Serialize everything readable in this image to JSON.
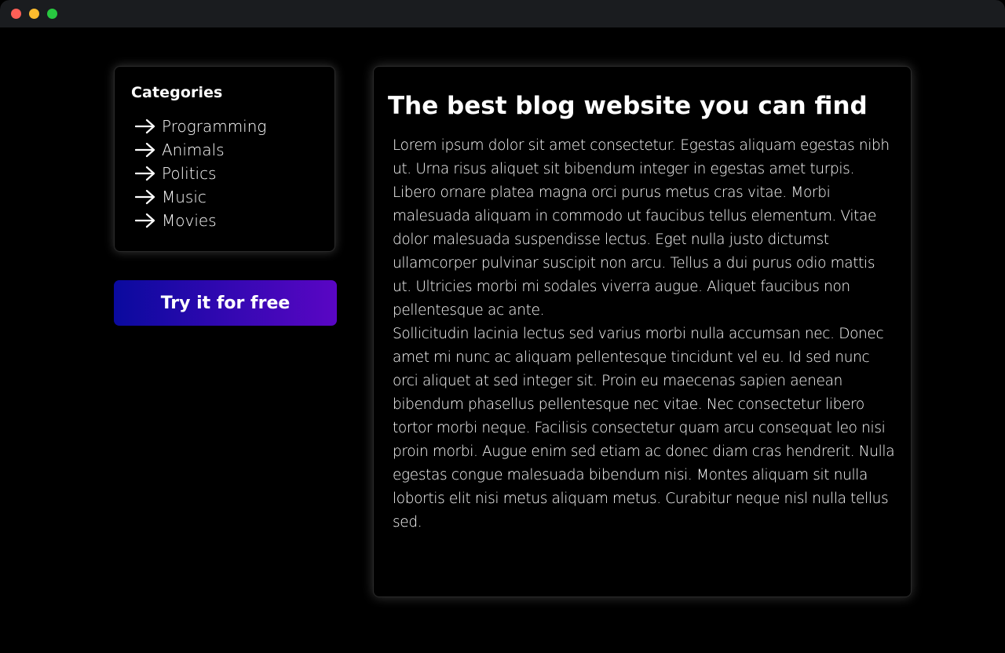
{
  "window": {
    "controls": {
      "close": "#ff5f57",
      "minimize": "#febc2e",
      "zoom": "#28c840"
    }
  },
  "colors": {
    "background": "#000000",
    "titlebar": "#1a1c1f",
    "text": "#ffffff",
    "button_gradient_start": "#0a0a9e",
    "button_gradient_end": "#5a06c4"
  },
  "sidebar": {
    "title": "Categories",
    "items": [
      {
        "label": "Programming",
        "icon": "arrow-right-icon"
      },
      {
        "label": "Animals",
        "icon": "arrow-right-icon"
      },
      {
        "label": "Politics",
        "icon": "arrow-right-icon"
      },
      {
        "label": "Music",
        "icon": "arrow-right-icon"
      },
      {
        "label": "Movies",
        "icon": "arrow-right-icon"
      }
    ],
    "cta_label": "Try it for free"
  },
  "article": {
    "title": "The best blog website you can find",
    "paragraphs": [
      "Lorem ipsum dolor sit amet consectetur. Egestas aliquam egestas nibh ut. Urna risus aliquet sit bibendum integer in egestas amet turpis. Libero ornare platea magna orci purus metus cras vitae. Morbi malesuada aliquam in commodo ut faucibus tellus elementum. Vitae dolor malesuada suspendisse lectus. Eget nulla justo dictumst ullamcorper pulvinar suscipit non arcu. Tellus a dui purus odio mattis ut. Ultricies morbi mi sodales viverra augue. Aliquet faucibus non pellentesque ac ante.",
      "Sollicitudin lacinia lectus sed varius morbi nulla accumsan nec. Donec amet mi nunc ac aliquam pellentesque tincidunt vel eu. Id sed nunc orci aliquet at sed integer sit. Proin eu maecenas sapien aenean bibendum phasellus pellentesque nec vitae. Nec consectetur libero tortor morbi neque. Facilisis consectetur quam arcu consequat leo nisi proin morbi. Augue enim sed etiam ac donec diam cras hendrerit. Nulla egestas congue malesuada bibendum nisi. Montes aliquam sit nulla lobortis elit nisi metus aliquam metus. Curabitur neque nisl nulla tellus sed."
    ]
  }
}
